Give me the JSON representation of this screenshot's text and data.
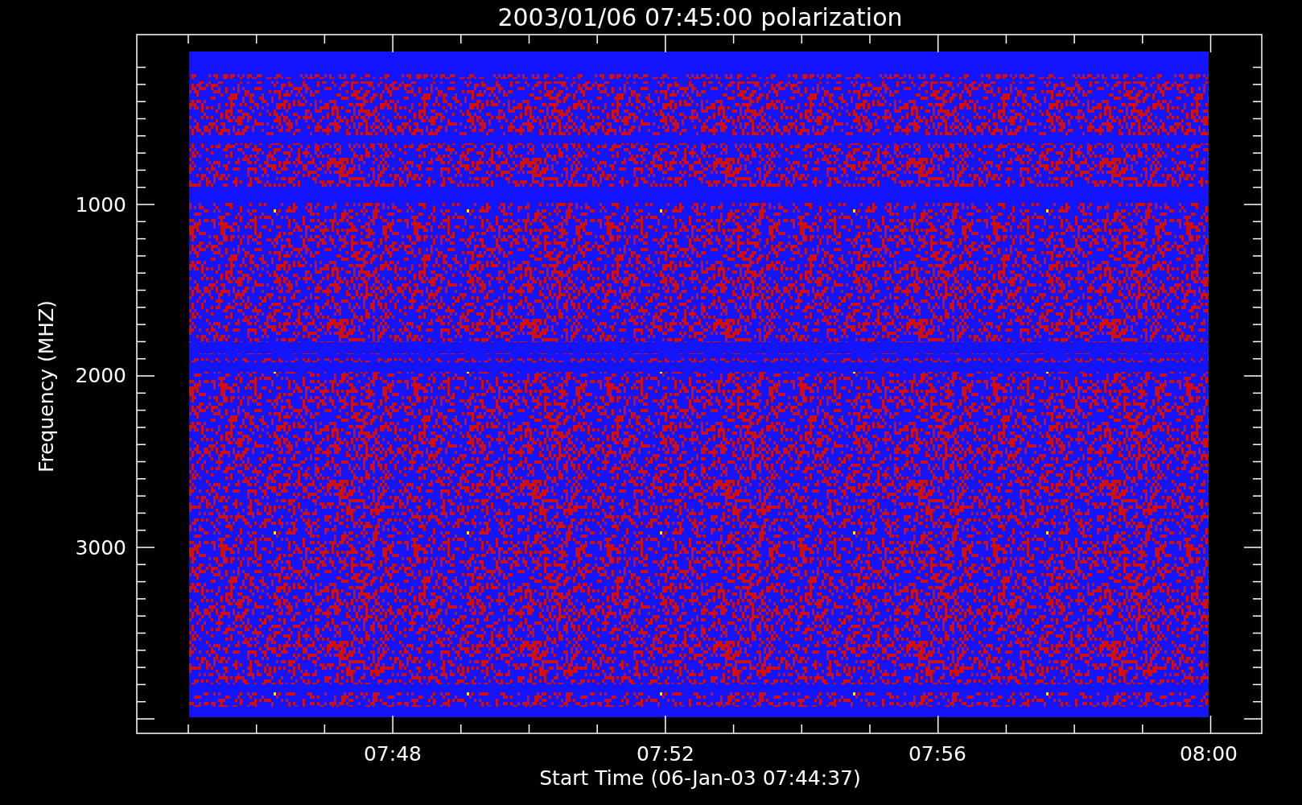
{
  "title": "2003/01/06 07:45:00 polarization",
  "y_axis": {
    "label": "Frequency (MHZ)",
    "ticks": [
      "1000",
      "2000",
      "3000"
    ]
  },
  "x_axis": {
    "label": "Start Time (06-Jan-03 07:44:37)",
    "ticks": [
      "07:48",
      "07:52",
      "07:56",
      "08:00"
    ]
  }
}
